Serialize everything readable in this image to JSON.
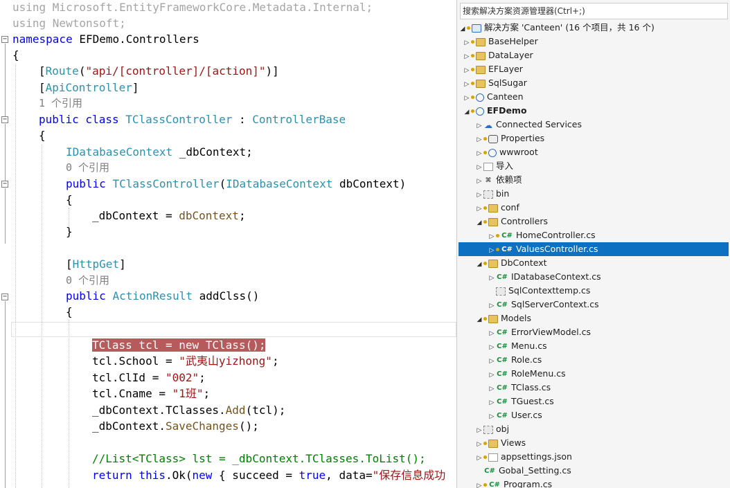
{
  "editor": {
    "using1": "using Microsoft.EntityFrameworkCore.Metadata.Internal;",
    "using2": "using Newtonsoft;",
    "ns_kw": "namespace",
    "ns_name": " EFDemo.Controllers",
    "brace_open": "{",
    "brace_close": "}",
    "route_open": "[",
    "route_attr": "Route",
    "route_paren": "(",
    "route_str": "\"api/[controller]/[action]\"",
    "route_close": ")]",
    "api_open": "[",
    "api_attr": "ApiController",
    "api_close": "]",
    "refs_class": "1 个引用",
    "class_kw": "public class ",
    "class_name": "TClassController",
    "class_colon": " : ",
    "class_base": "ControllerBase",
    "field_type": "IDatabaseContext",
    "field_name": " _dbContext;",
    "refs_ctor": "0 个引用",
    "ctor_kw": "public ",
    "ctor_name": "TClassController",
    "ctor_paren": "(",
    "ctor_ptype": "IDatabaseContext",
    "ctor_pname": " dbContext)",
    "assign_left": "_dbContext = ",
    "assign_right": "dbContext",
    "assign_end": ";",
    "httpget_open": "[",
    "httpget_attr": "HttpGet",
    "httpget_close": "]",
    "refs_method": "0 个引用",
    "method_kw": "public ",
    "method_type": "ActionResult",
    "method_name": " addClss()",
    "hl_type1": "TClass",
    "hl_mid": " tcl = ",
    "hl_new": "new",
    "hl_type2": " TClass",
    "hl_end": "();",
    "school_left": "tcl.School = ",
    "school_str": "\"武夷山yizhong\"",
    "school_end": ";",
    "clid_left": "tcl.ClId = ",
    "clid_str": "\"002\"",
    "clid_end": ";",
    "cname_left": "tcl.Cname = ",
    "cname_str": "\"1班\"",
    "cname_end": ";",
    "add_left": "_dbContext.TClasses.",
    "add_meth": "Add",
    "add_end": "(tcl);",
    "save_left": "_dbContext.",
    "save_meth": "SaveChanges",
    "save_end": "();",
    "comment": "//List<TClass> lst = _dbContext.TClasses.ToList();",
    "ret_kw": "return ",
    "ret_this": "this",
    "ret_ok": ".Ok(",
    "ret_new": "new",
    "ret_mid": " { succeed = ",
    "ret_true": "true",
    "ret_data": ", data=",
    "ret_str": "\"保存信息成功"
  },
  "solution_explorer": {
    "search_placeholder": "搜索解决方案资源管理器(Ctrl+;)",
    "rows": [
      {
        "label": "解决方案 'Canteen' (16 个项目，共 16 个)"
      },
      {
        "label": "BaseHelper"
      },
      {
        "label": "DataLayer"
      },
      {
        "label": "EFLayer"
      },
      {
        "label": "SqlSugar"
      },
      {
        "label": "Canteen"
      },
      {
        "label": "EFDemo"
      },
      {
        "label": "Connected Services"
      },
      {
        "label": "Properties"
      },
      {
        "label": "wwwroot"
      },
      {
        "label": "导入"
      },
      {
        "label": "依赖项"
      },
      {
        "label": "bin"
      },
      {
        "label": "conf"
      },
      {
        "label": "Controllers"
      },
      {
        "label": "HomeController.cs"
      },
      {
        "label": "ValuesController.cs"
      },
      {
        "label": "DbContext"
      },
      {
        "label": "IDatabaseContext.cs"
      },
      {
        "label": "SqlContexttemp.cs"
      },
      {
        "label": "SqlServerContext.cs"
      },
      {
        "label": "Models"
      },
      {
        "label": "ErrorViewModel.cs"
      },
      {
        "label": "Menu.cs"
      },
      {
        "label": "Role.cs"
      },
      {
        "label": "RoleMenu.cs"
      },
      {
        "label": "TClass.cs"
      },
      {
        "label": "TGuest.cs"
      },
      {
        "label": "User.cs"
      },
      {
        "label": "obj"
      },
      {
        "label": "Views"
      },
      {
        "label": "appsettings.json"
      },
      {
        "label": "Gobal_Setting.cs"
      },
      {
        "label": "Program.cs"
      }
    ],
    "cs_badge": "C#"
  },
  "colors": {
    "keyword": "#0000ff",
    "type": "#2b91af",
    "string": "#a31515",
    "comment": "#008000",
    "highlight": "#b55b5b",
    "selection": "#0e70c0"
  }
}
